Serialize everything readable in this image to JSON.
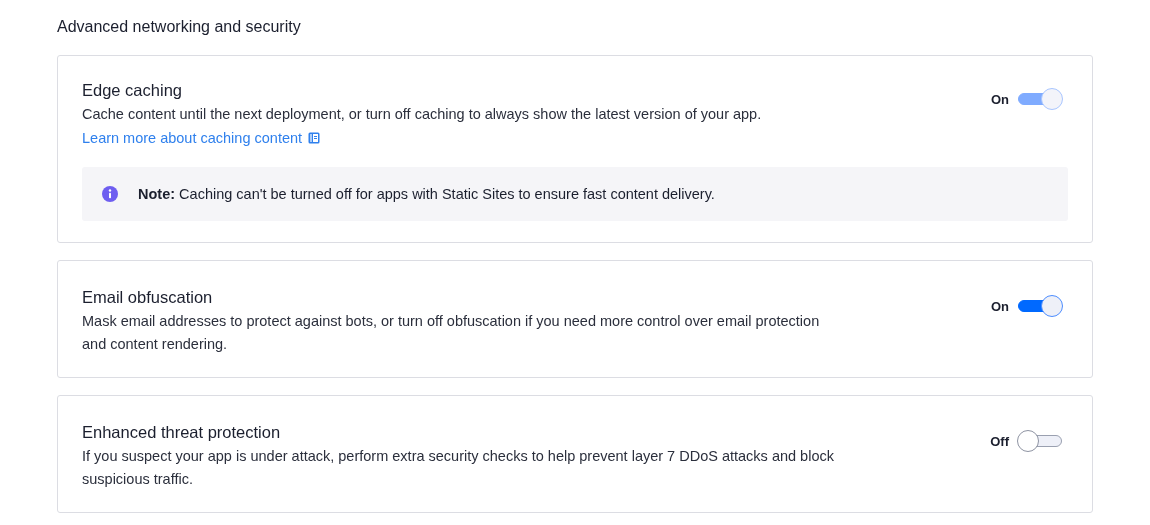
{
  "heading": "Advanced networking and security",
  "settings": [
    {
      "title": "Edge caching",
      "description": "Cache content until the next deployment, or turn off caching to always show the latest version of your app.",
      "link": "Learn more about caching content",
      "note": "**Note:** Caching can't be turned off for apps with Static Sites to ensure fast content delivery.",
      "toggle_label": "On",
      "on": true,
      "disabled": true
    },
    {
      "title": "Email obfuscation",
      "description": "Mask email addresses to protect against bots, or turn off obfuscation if you need more control over email protection and content rendering.",
      "toggle_label": "On",
      "on": true,
      "disabled": false
    },
    {
      "title": "Enhanced threat protection",
      "description": "If you suspect your app is under attack, perform extra security checks to help prevent layer 7 DDoS attacks and block suspicious traffic.",
      "toggle_label": "Off",
      "on": false,
      "disabled": false
    }
  ]
}
